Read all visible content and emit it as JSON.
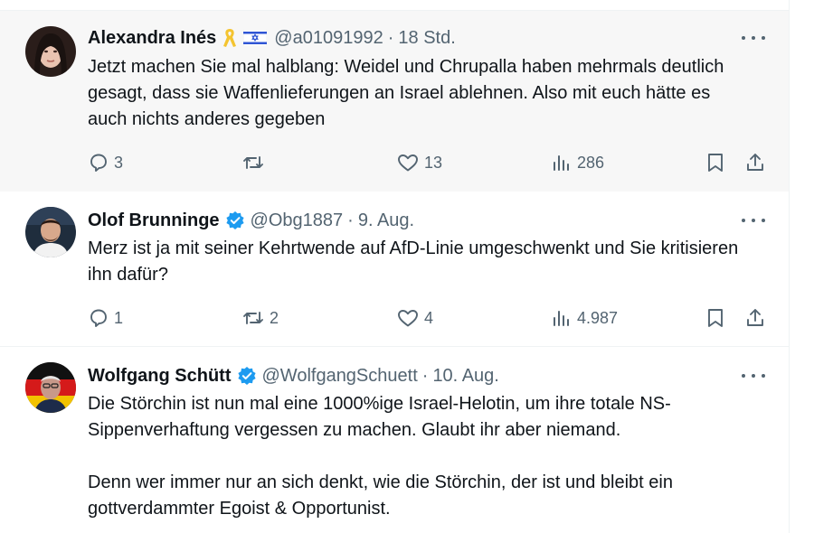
{
  "tweets": [
    {
      "name": "Alexandra Inés",
      "handle": "@a01091992",
      "separator": "·",
      "time": "18 Std.",
      "badges": [
        "yellow-ribbon-icon",
        "israel-flag-icon"
      ],
      "verified": false,
      "text": [
        "Jetzt machen Sie mal halblang: Weidel und Chrupalla haben mehrmals deutlich gesagt, dass sie Waffenlieferungen an Israel ablehnen. Also mit euch hätte es auch nichts anderes gegeben"
      ],
      "replies": "3",
      "reposts": "",
      "likes": "13",
      "views": "286"
    },
    {
      "name": "Olof Brunninge",
      "handle": "@Obg1887",
      "separator": "·",
      "time": "9. Aug.",
      "verified": true,
      "text": [
        "Merz ist ja mit seiner Kehrtwende auf AfD-Linie umgeschwenkt und Sie kritisieren ihn dafür?"
      ],
      "replies": "1",
      "reposts": "2",
      "likes": "4",
      "views": "4.987"
    },
    {
      "name": "Wolfgang Schütt",
      "handle": "@WolfgangSchuett",
      "separator": "·",
      "time": "10. Aug.",
      "verified": true,
      "text": [
        "Die Störchin ist nun mal eine 1000%ige Israel-Helotin, um ihre totale NS-Sippenverhaftung vergessen zu machen. Glaubt ihr aber niemand.",
        "Denn wer immer nur an sich denkt, wie die Störchin, der ist und bleibt ein gottverdammter Egoist & Opportunist."
      ]
    }
  ],
  "colors": {
    "verified": "#1d9bf0",
    "secondary_text": "#536471",
    "highlight_bg": "#f7f7f7",
    "ribbon": "#f4c430",
    "flag_blue": "#2f55d4"
  }
}
